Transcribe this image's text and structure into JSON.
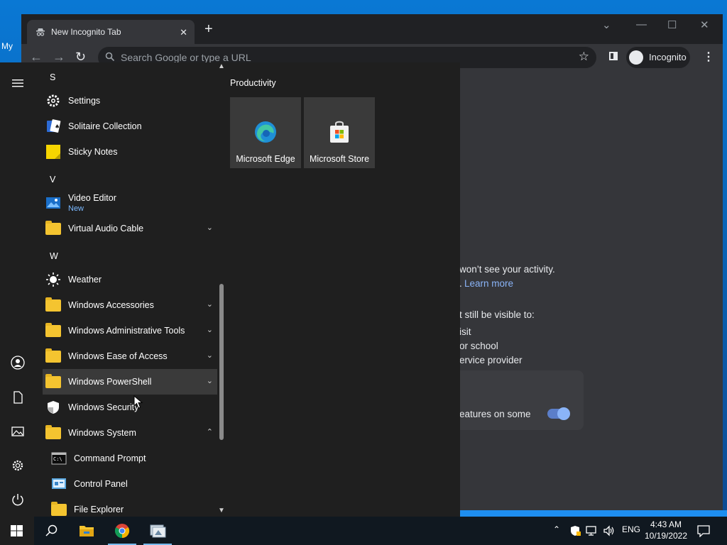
{
  "desktop": {
    "label": "My"
  },
  "chrome": {
    "tab_title": "New Incognito Tab",
    "tab_close": "✕",
    "new_tab": "+",
    "window_controls": {
      "dropdown": "⌄",
      "minimize": "—",
      "maximize": "☐",
      "close": "✕"
    },
    "nav": {
      "back": "←",
      "forward": "→",
      "reload": "↻"
    },
    "omnibox_placeholder": "Search Google or type a URL",
    "bookmark_star": "☆",
    "profile_label": "Incognito",
    "menu_glyph": "⋮",
    "content": {
      "line1": "won’t see your activity.",
      "learn_more_prefix": ".",
      "learn_more": "Learn more",
      "visible_to": "t still be visible to:",
      "item1": "isit",
      "item2": "or school",
      "item3": "ervice provider",
      "setting_text": "eatures on some",
      "toggle_on": true
    }
  },
  "start_menu": {
    "rail": [
      {
        "name": "hamburger-menu-icon",
        "glyph": "☰"
      },
      {
        "name": "user-account-icon",
        "glyph": "○"
      },
      {
        "name": "documents-icon",
        "glyph": "▯"
      },
      {
        "name": "pictures-icon",
        "glyph": "▭"
      },
      {
        "name": "settings-gear-icon",
        "glyph": "⚙"
      },
      {
        "name": "power-icon",
        "glyph": "⏻"
      }
    ],
    "letters": {
      "s": "S",
      "v": "V",
      "w": "W"
    },
    "apps": {
      "settings": "Settings",
      "solitaire": "Solitaire Collection",
      "sticky_notes": "Sticky Notes",
      "video_editor": "Video Editor",
      "video_editor_badge": "New",
      "virtual_audio_cable": "Virtual Audio Cable",
      "weather": "Weather",
      "win_accessories": "Windows Accessories",
      "win_admin_tools": "Windows Administrative Tools",
      "win_ease": "Windows Ease of Access",
      "win_powershell": "Windows PowerShell",
      "win_security": "Windows Security",
      "win_system": "Windows System",
      "cmd": "Command Prompt",
      "control_panel": "Control Panel",
      "file_explorer": "File Explorer"
    },
    "chevron_down": "⌄",
    "chevron_up": "⌃",
    "tiles": {
      "group_title": "Productivity",
      "edge": "Microsoft Edge",
      "store": "Microsoft Store"
    }
  },
  "taskbar": {
    "tray": {
      "chevron": "⌃",
      "language": "ENG",
      "notification": "☐"
    },
    "clock_time": "4:43 AM",
    "clock_date": "10/19/2022"
  }
}
